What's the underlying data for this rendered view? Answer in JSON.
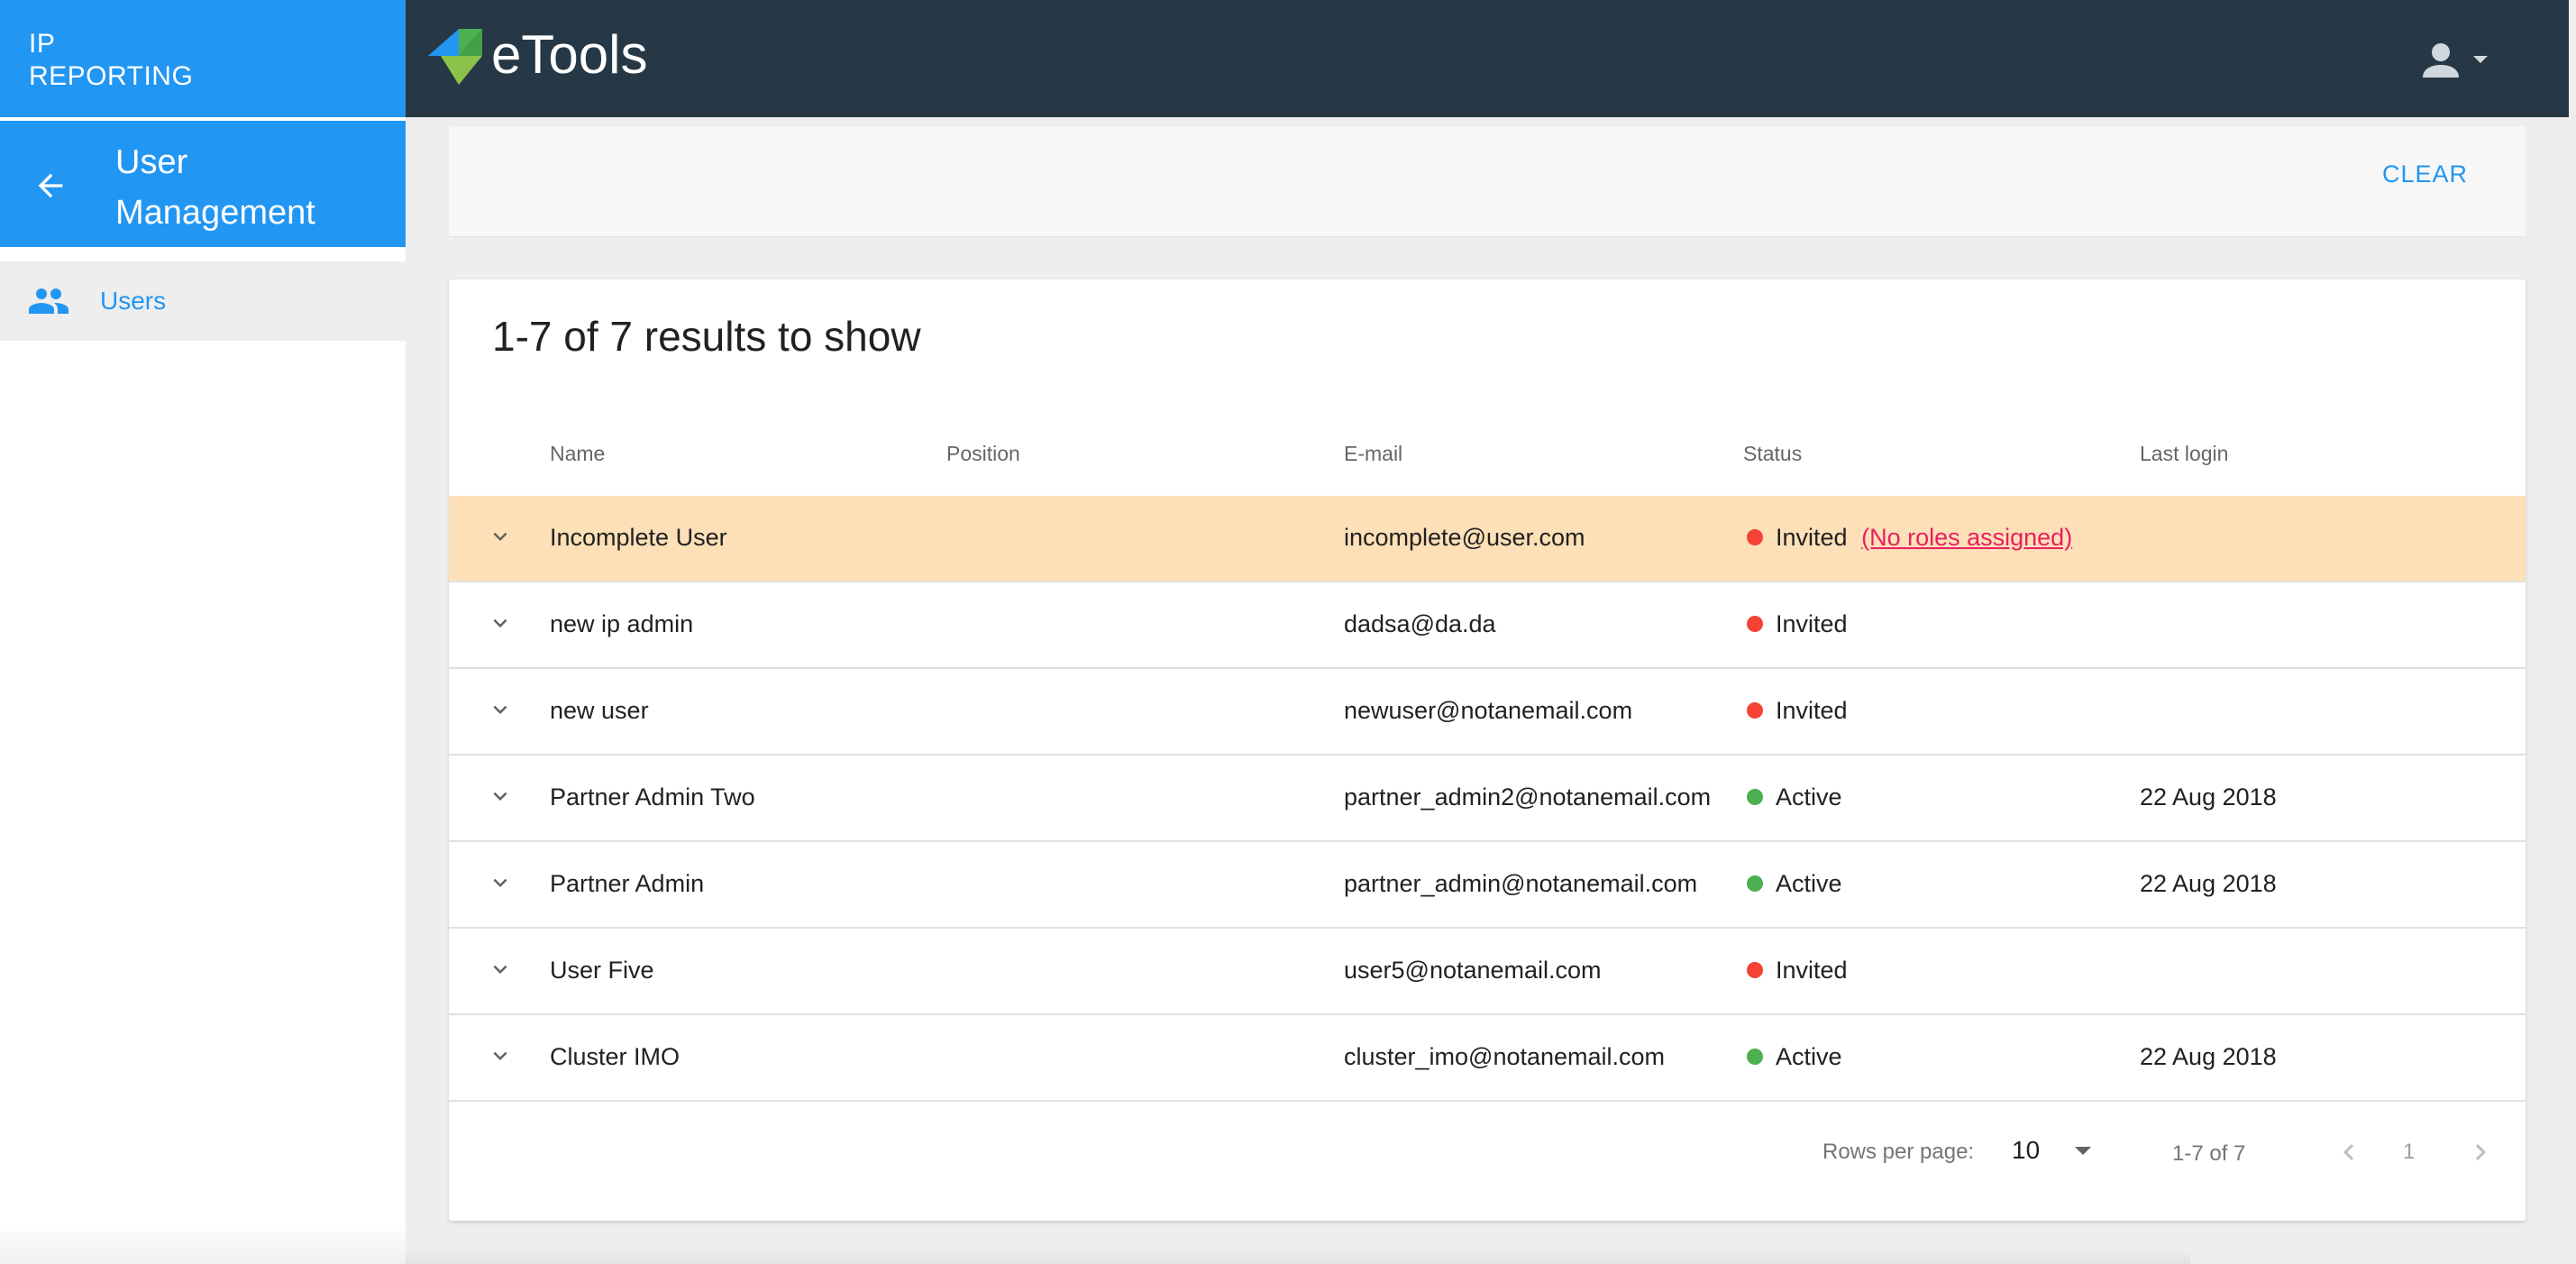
{
  "sidebar": {
    "brand_line1": "IP",
    "brand_line2": "REPORTING",
    "section_title": "User Management",
    "items": [
      {
        "label": "Users",
        "icon": "people-icon"
      }
    ]
  },
  "header": {
    "logo_text": "eTools",
    "account_icon": "account-icon"
  },
  "filters": {
    "clear_label": "CLEAR"
  },
  "table": {
    "results_title": "1-7 of 7 results to show",
    "columns": [
      "Name",
      "Position",
      "E-mail",
      "Status",
      "Last login"
    ],
    "rows": [
      {
        "name": "Incomplete User",
        "position": "",
        "email": "incomplete@user.com",
        "status": "Invited",
        "note": "(No roles assigned)",
        "last_login": ""
      },
      {
        "name": "new ip admin",
        "position": "",
        "email": "dadsa@da.da",
        "status": "Invited",
        "last_login": ""
      },
      {
        "name": "new user",
        "position": "",
        "email": "newuser@notanemail.com",
        "status": "Invited",
        "last_login": ""
      },
      {
        "name": "Partner Admin Two",
        "position": "",
        "email": "partner_admin2@notanemail.com",
        "status": "Active",
        "last_login": "22 Aug 2018"
      },
      {
        "name": "Partner Admin",
        "position": "",
        "email": "partner_admin@notanemail.com",
        "status": "Active",
        "last_login": "22 Aug 2018"
      },
      {
        "name": "User Five",
        "position": "",
        "email": "user5@notanemail.com",
        "status": "Invited",
        "last_login": ""
      },
      {
        "name": "Cluster IMO",
        "position": "",
        "email": "cluster_imo@notanemail.com",
        "status": "Active",
        "last_login": "22 Aug 2018"
      }
    ]
  },
  "pagination": {
    "rows_per_page_label": "Rows per page:",
    "rows_per_page": "10",
    "range": "1-7 of 7",
    "page": "1"
  },
  "colors": {
    "primary": "#2196f3",
    "topbar": "#263845",
    "highlight_row": "#fde0b7",
    "invited": "#f44336",
    "active": "#4caf50",
    "warning_link": "#e91e63"
  }
}
